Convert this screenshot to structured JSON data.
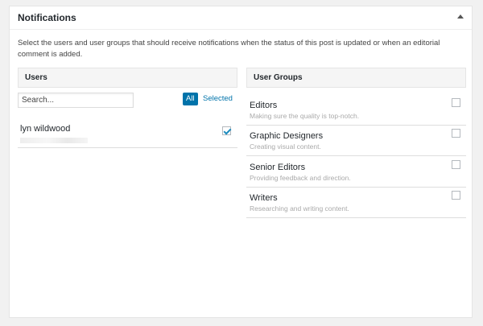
{
  "panel": {
    "title": "Notifications",
    "description": "Select the users and user groups that should receive notifications when the status of this post is updated or when an editorial comment is added."
  },
  "users": {
    "header": "Users",
    "search_placeholder": "Search...",
    "filter_all": "All",
    "filter_selected": "Selected",
    "items": [
      {
        "name": "lyn wildwood",
        "checked": true
      }
    ]
  },
  "groups": {
    "header": "User Groups",
    "items": [
      {
        "name": "Editors",
        "desc": "Making sure the quality is top-notch.",
        "checked": false
      },
      {
        "name": "Graphic Designers",
        "desc": "Creating visual content.",
        "checked": false
      },
      {
        "name": "Senior Editors",
        "desc": "Providing feedback and direction.",
        "checked": false
      },
      {
        "name": "Writers",
        "desc": "Researching and writing content.",
        "checked": false
      }
    ]
  },
  "colors": {
    "accent": "#0073aa",
    "check": "#1e8cbe"
  }
}
